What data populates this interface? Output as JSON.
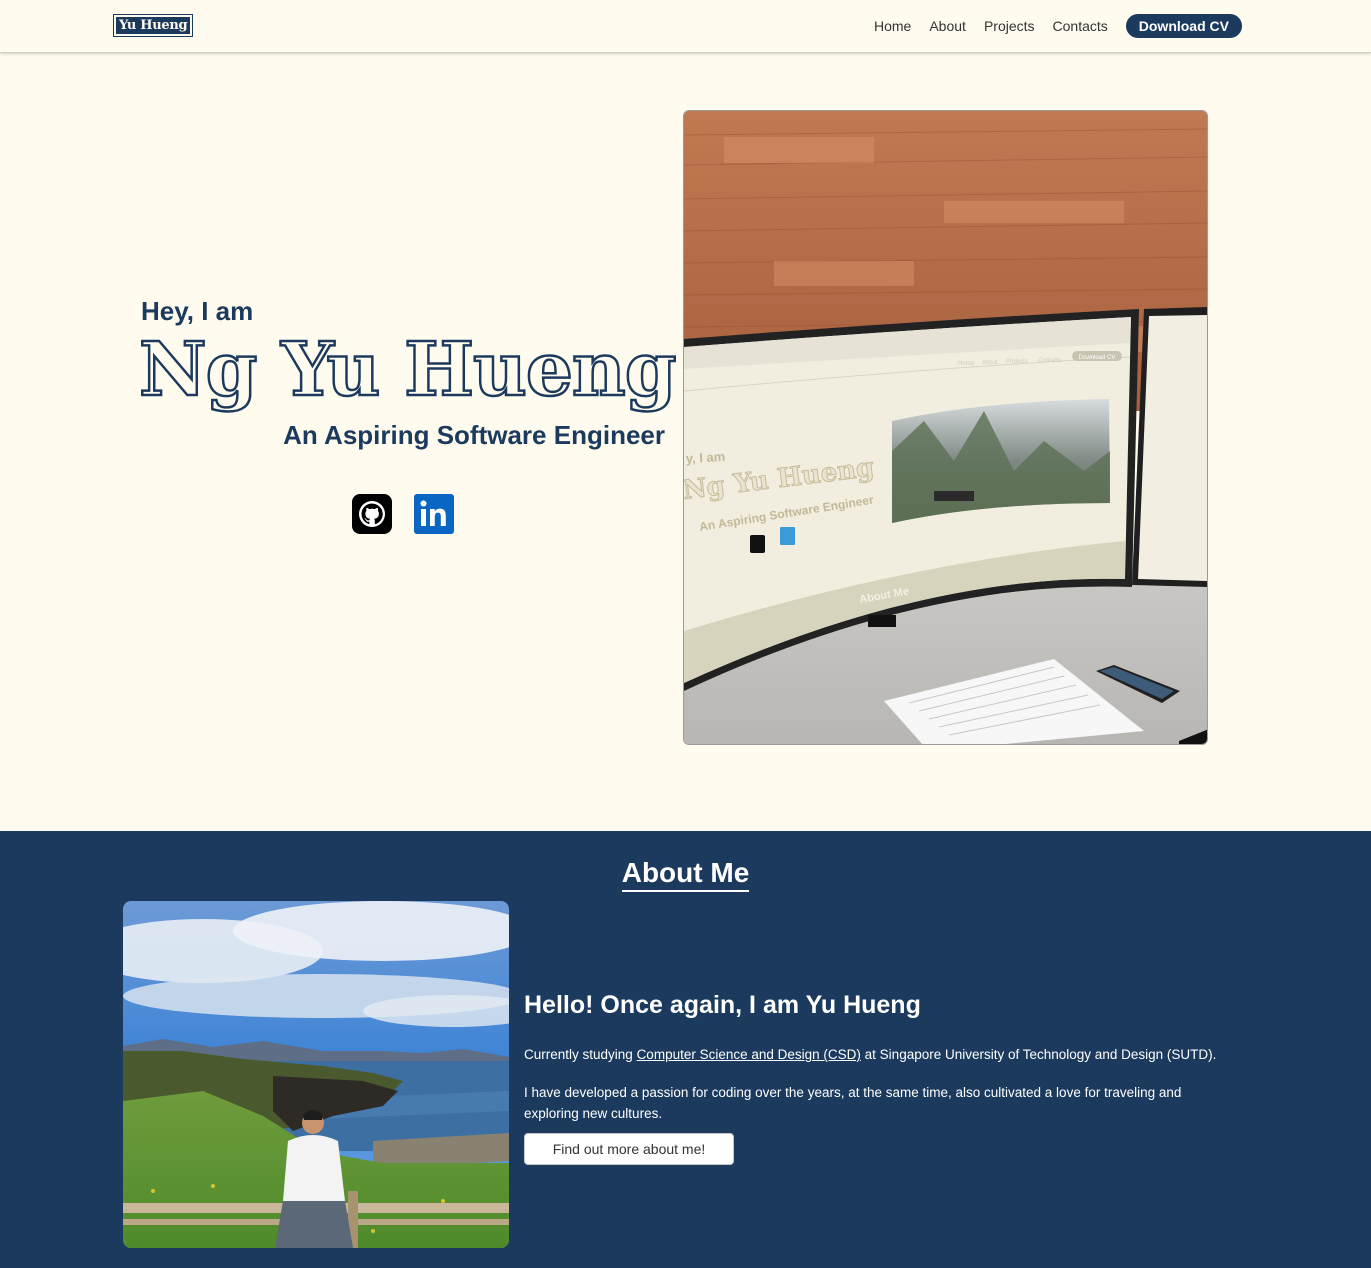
{
  "nav": {
    "logo_text": "Yu Hueng",
    "links": [
      "Home",
      "About",
      "Projects",
      "Contacts"
    ],
    "cv_button": "Download CV"
  },
  "hero": {
    "intro": "Hey, I am",
    "name": "Ng Yu Hueng",
    "subtitle": "An Aspiring Software Engineer",
    "icons": [
      "github-icon",
      "linkedin-icon"
    ],
    "preview": {
      "nav_links": [
        "Home",
        "About",
        "Projects",
        "Contacts"
      ],
      "cv_button": "Download CV",
      "intro": "y, I am",
      "name": "Ng Yu Hueng",
      "subtitle": "An Aspiring Software Engineer",
      "about_label": "About Me"
    }
  },
  "about": {
    "title": "About Me",
    "heading": "Hello! Once again, I am Yu Hueng",
    "p1_prefix": "Currently studying ",
    "p1_link": "Computer Science and Design (CSD)",
    "p1_suffix": " at Singapore University of Technology and Design (SUTD).",
    "p2": "I have developed a passion for coding over the years, at the same time, also cultivated a love for traveling and exploring new cultures.",
    "button": "Find out more about me!"
  },
  "colors": {
    "background": "#fffbee",
    "primary": "#1b3a5e",
    "white": "#ffffff"
  }
}
